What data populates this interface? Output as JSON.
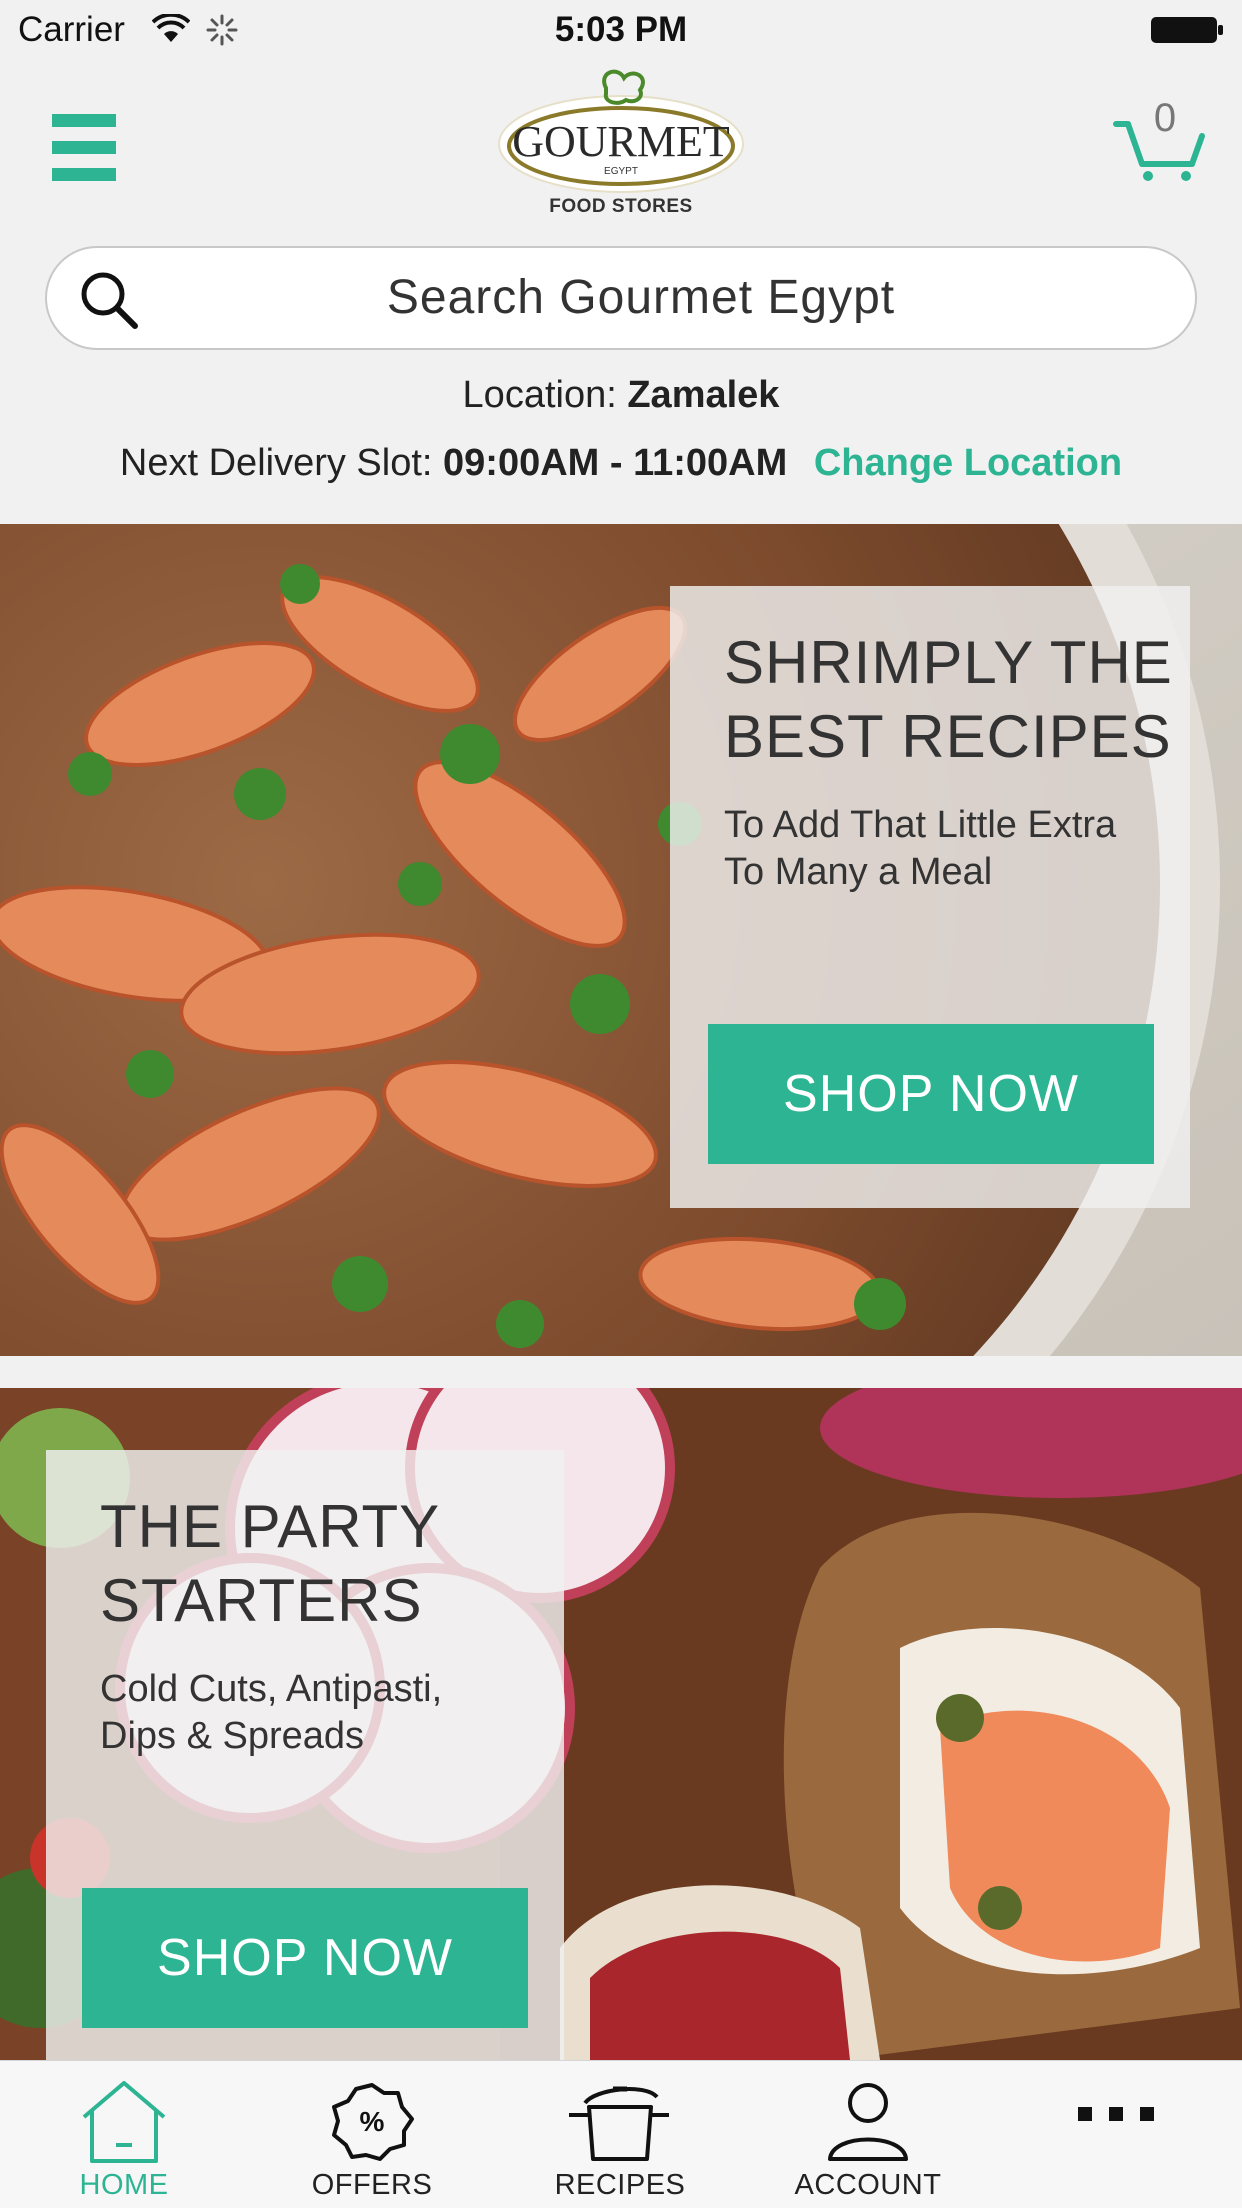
{
  "status_bar": {
    "carrier": "Carrier",
    "time": "5:03 PM"
  },
  "header": {
    "logo": {
      "brand": "GOURMET",
      "region": "EGYPT",
      "tagline": "FOOD STORES"
    },
    "cart_count": "0"
  },
  "search": {
    "placeholder": "Search Gourmet Egypt"
  },
  "location": {
    "label": "Location:",
    "value": "Zamalek",
    "slot_label": "Next Delivery Slot:",
    "slot_value": "09:00AM - 11:00AM",
    "change_label": "Change Location"
  },
  "banners": [
    {
      "title_line1": "SHRIMPLY THE",
      "title_line2": "BEST RECIPES",
      "sub_line1": "To Add That Little Extra",
      "sub_line2": "To Many a Meal",
      "button": "SHOP NOW"
    },
    {
      "title_line1": "THE PARTY",
      "title_line2": "STARTERS",
      "sub_line1": "Cold Cuts, Antipasti,",
      "sub_line2": "Dips & Spreads",
      "button": "SHOP NOW"
    }
  ],
  "tabs": [
    {
      "label": "HOME",
      "icon": "home-icon",
      "active": true
    },
    {
      "label": "OFFERS",
      "icon": "offers-icon",
      "active": false
    },
    {
      "label": "RECIPES",
      "icon": "pot-icon",
      "active": false
    },
    {
      "label": "ACCOUNT",
      "icon": "user-icon",
      "active": false
    },
    {
      "label": "",
      "icon": "more-icon",
      "active": false
    }
  ],
  "colors": {
    "accent": "#2db493",
    "background": "#f1f1f1",
    "logo_olive": "#8a7a2a"
  }
}
